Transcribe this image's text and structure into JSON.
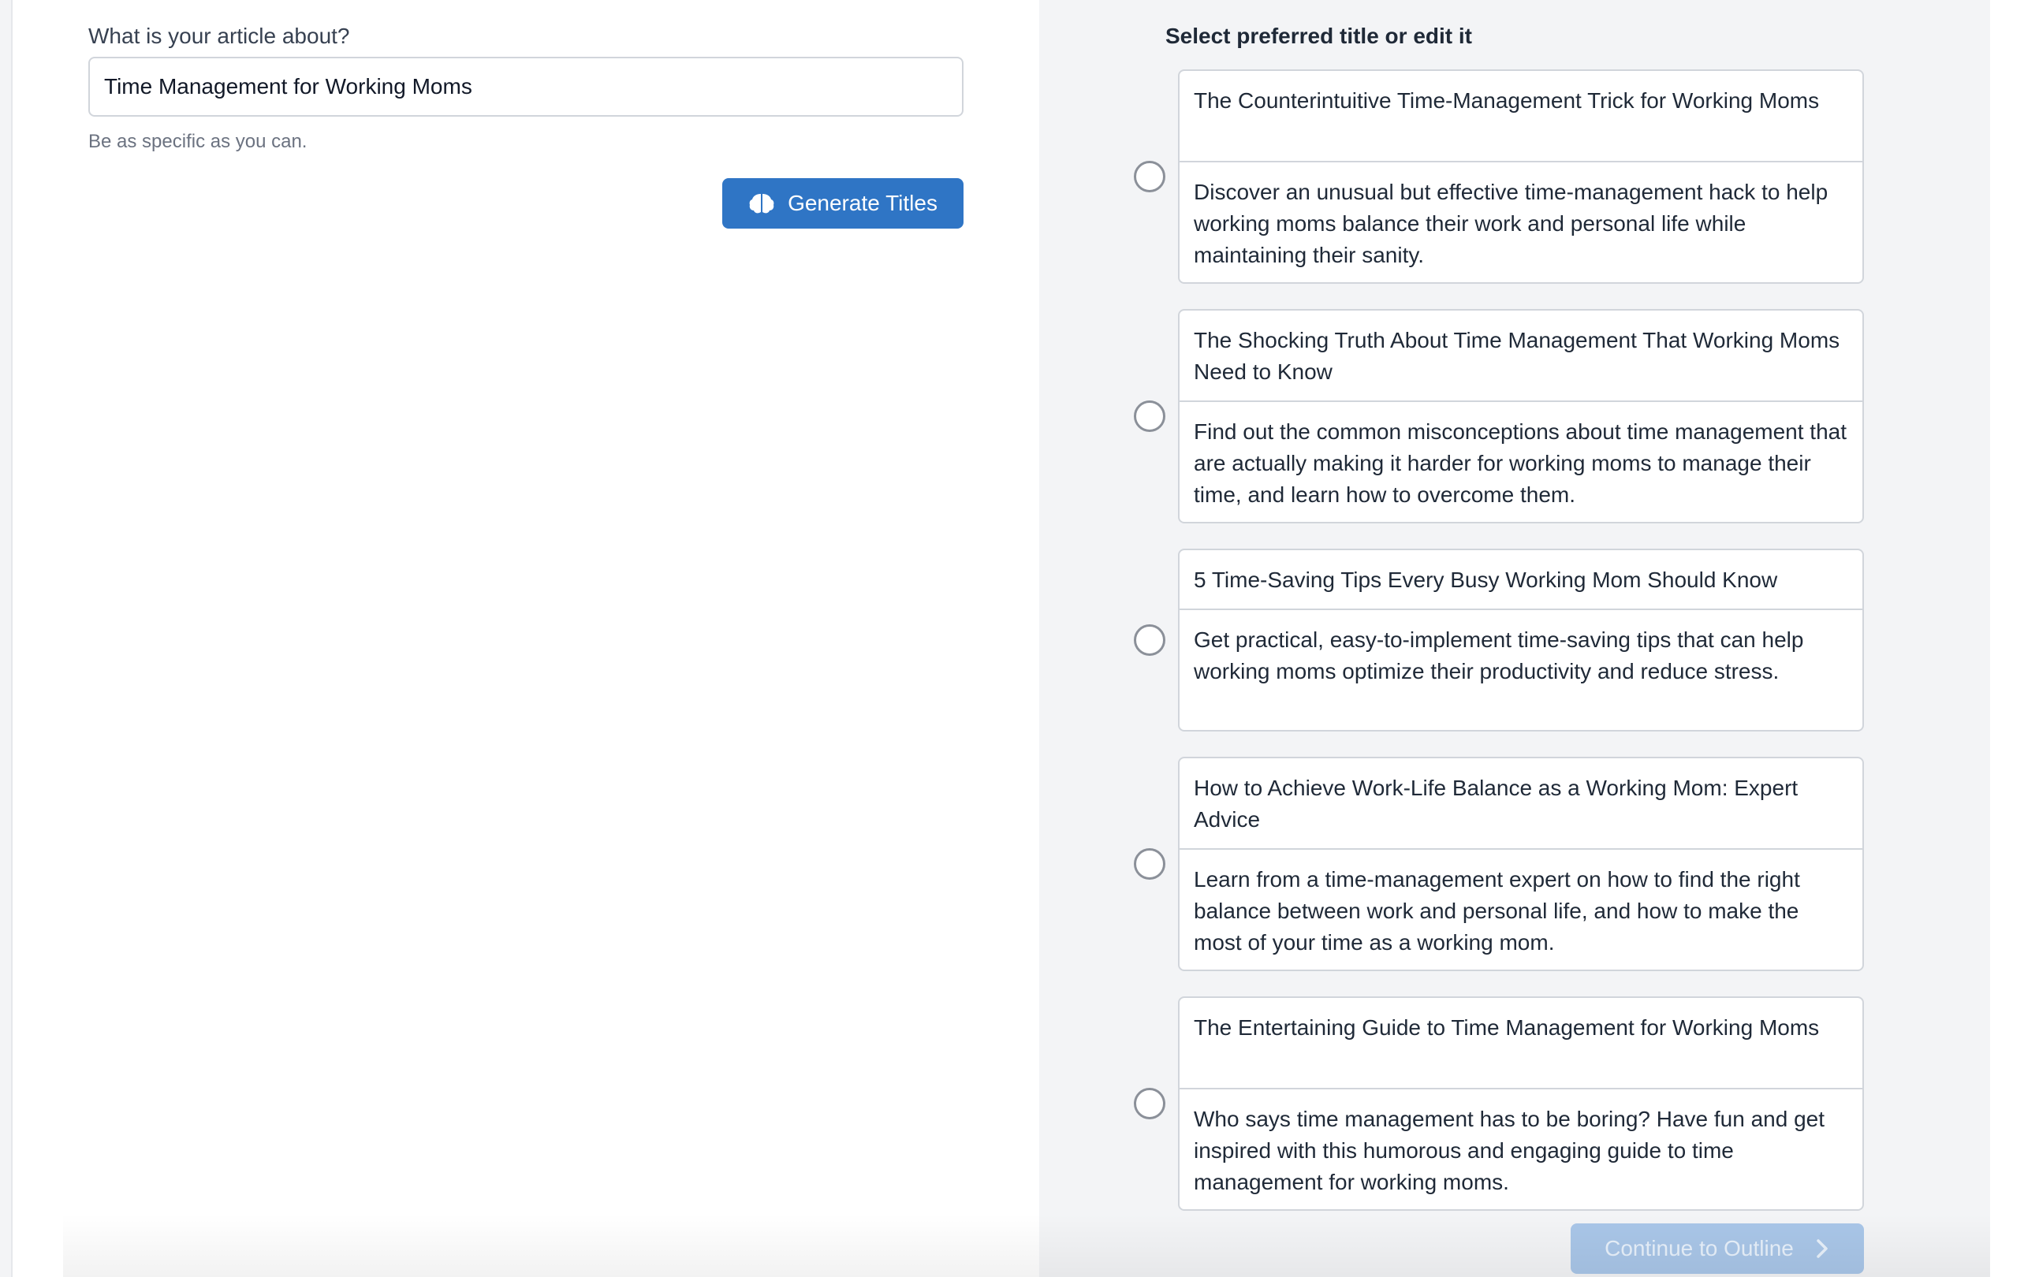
{
  "form": {
    "topic_label": "What is your article about?",
    "topic_value": "Time Management for Working Moms",
    "topic_hint": "Be as specific as you can.",
    "generate_label": "Generate Titles"
  },
  "titles_panel": {
    "heading": "Select preferred title or edit it",
    "options": [
      {
        "title": "The Counterintuitive Time-Management Trick for Working Moms",
        "description": "Discover an unusual but effective time-management hack to help working moms balance their work and personal life while maintaining their sanity."
      },
      {
        "title": "The Shocking Truth About Time Management That Working Moms Need to Know",
        "description": "Find out the common misconceptions about time management that are actually making it harder for working moms to manage their time, and learn how to overcome them."
      },
      {
        "title": "5 Time-Saving Tips Every Busy Working Mom Should Know",
        "description": "Get practical, easy-to-implement time-saving tips that can help working moms optimize their productivity and reduce stress."
      },
      {
        "title": "How to Achieve Work-Life Balance as a Working Mom: Expert Advice",
        "description": "Learn from a time-management expert on how to find the right balance between work and personal life, and how to make the most of your time as a working mom."
      },
      {
        "title": "The Entertaining Guide to Time Management for Working Moms",
        "description": "Who says time management has to be boring? Have fun and get inspired with this humorous and engaging guide to time management for working moms."
      }
    ],
    "continue_label": "Continue to Outline"
  },
  "colors": {
    "primary": "#2f75c5",
    "primary_disabled": "#a9c6e8",
    "panel_bg": "#f3f4f6"
  },
  "icons": {
    "generate": "brain-icon",
    "continue": "chevron-right-icon"
  }
}
